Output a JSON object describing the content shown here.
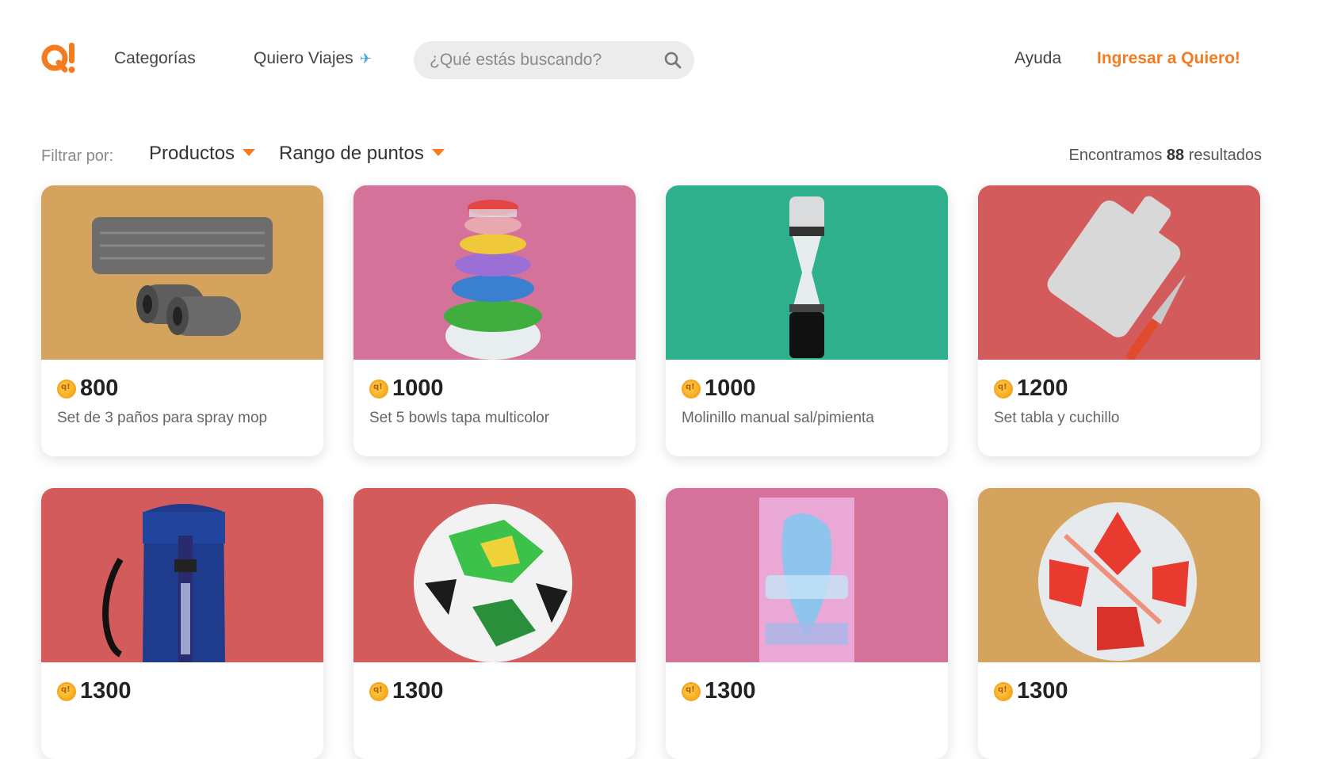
{
  "header": {
    "logo_text": "Q!",
    "nav_categorias": "Categorías",
    "nav_viajes": "Quiero Viajes",
    "search_placeholder": "¿Qué estás buscando?",
    "nav_ayuda": "Ayuda",
    "nav_login": "Ingresar a Quiero!",
    "accent_color": "#f47b20"
  },
  "filters": {
    "label": "Filtrar por:",
    "dropdown_products": "Productos",
    "dropdown_range": "Rango de puntos",
    "results_prefix": "Encontramos",
    "results_count": "88",
    "results_suffix": "resultados"
  },
  "products": [
    {
      "price": "800",
      "name": "Set de 3 paños para spray mop",
      "bg": "#d4a35e",
      "icon": "mop-pads-image"
    },
    {
      "price": "1000",
      "name": "Set 5 bowls tapa multicolor",
      "bg": "#d4729a",
      "icon": "bowls-image"
    },
    {
      "price": "1000",
      "name": "Molinillo manual sal/pimienta",
      "bg": "#2fb08c",
      "icon": "grinder-image"
    },
    {
      "price": "1200",
      "name": "Set tabla y cuchillo",
      "bg": "#d45b5b",
      "icon": "cutting-board-image"
    },
    {
      "price": "1300",
      "name": "",
      "bg": "#d45b5b",
      "icon": "bag-image"
    },
    {
      "price": "1300",
      "name": "",
      "bg": "#d45b5b",
      "icon": "soccer-ball-green-image"
    },
    {
      "price": "1300",
      "name": "",
      "bg": "#d4729a",
      "icon": "towel-image"
    },
    {
      "price": "1300",
      "name": "",
      "bg": "#d4a35e",
      "icon": "soccer-ball-red-image"
    }
  ]
}
